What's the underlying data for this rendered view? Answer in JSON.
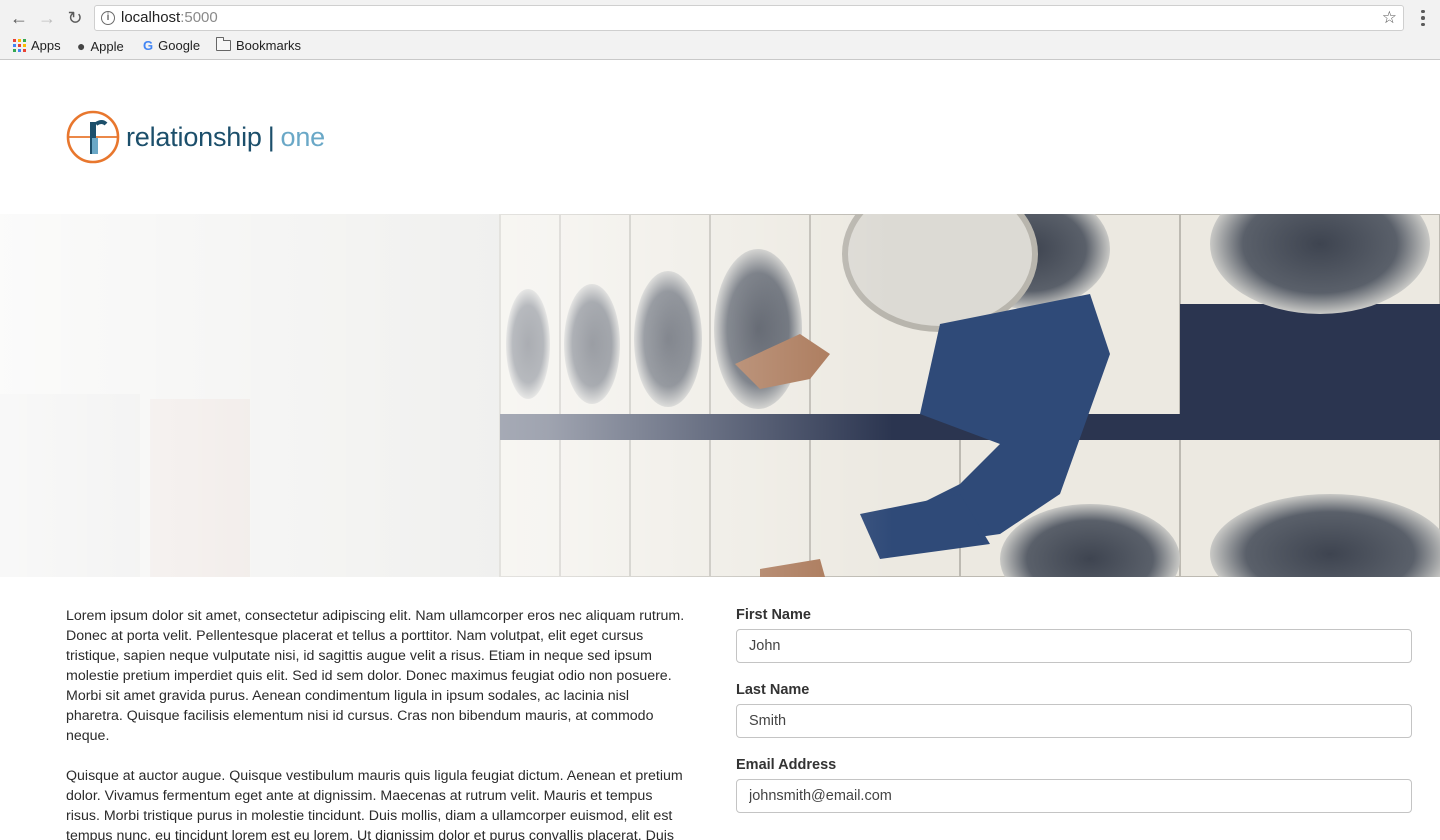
{
  "browser": {
    "url_host": "localhost",
    "url_port": ":5000",
    "bookmarks": [
      {
        "label": "Apps",
        "icon": "apps-grid-icon"
      },
      {
        "label": "Apple",
        "icon": "apple-icon"
      },
      {
        "label": "Google",
        "icon": "google-icon"
      },
      {
        "label": "Bookmarks",
        "icon": "folder-icon"
      }
    ]
  },
  "header": {
    "logo_word": "relationship",
    "logo_separator": "|",
    "logo_suffix": "one",
    "logo_orange": "#e8772e",
    "logo_navy": "#1c4f6b",
    "logo_light_blue": "#6aa8c7"
  },
  "content": {
    "paragraphs": [
      "Lorem ipsum dolor sit amet, consectetur adipiscing elit. Nam ullamcorper eros nec aliquam rutrum. Donec at porta velit. Pellentesque placerat et tellus a porttitor. Nam volutpat, elit eget cursus tristique, sapien neque vulputate nisi, id sagittis augue velit a risus. Etiam in neque sed ipsum molestie pretium imperdiet quis elit. Sed id sem dolor. Donec maximus feugiat odio non posuere. Morbi sit amet gravida purus. Aenean condimentum ligula in ipsum sodales, ac lacinia nisl pharetra. Quisque facilisis elementum nisi id cursus. Cras non bibendum mauris, at commodo neque.",
      "Quisque at auctor augue. Quisque vestibulum mauris quis ligula feugiat dictum. Aenean et pretium dolor. Vivamus fermentum eget ante at dignissim. Maecenas at rutrum velit. Mauris et tempus risus. Morbi tristique purus in molestie tincidunt. Duis mollis, diam a ullamcorper euismod, elit est tempus nunc, eu tincidunt lorem est eu lorem. Ut dignissim dolor et purus convallis placerat. Duis"
    ]
  },
  "form": {
    "first_name": {
      "label": "First Name",
      "value": "John"
    },
    "last_name": {
      "label": "Last Name",
      "value": "Smith"
    },
    "email": {
      "label": "Email Address",
      "value": "johnsmith@email.com"
    }
  }
}
